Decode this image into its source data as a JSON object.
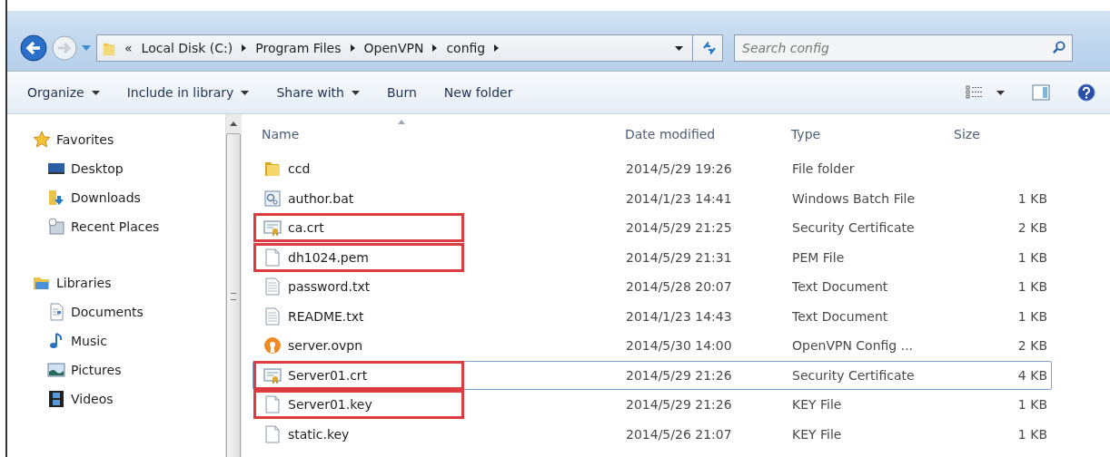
{
  "address_bar": {
    "overflow": "«",
    "segments": [
      "Local Disk (C:)",
      "Program Files",
      "OpenVPN",
      "config"
    ]
  },
  "search": {
    "placeholder": "Search config"
  },
  "toolbar": {
    "items": [
      {
        "label": "Organize",
        "dropdown": true
      },
      {
        "label": "Include in library",
        "dropdown": true
      },
      {
        "label": "Share with",
        "dropdown": true
      },
      {
        "label": "Burn",
        "dropdown": false
      },
      {
        "label": "New folder",
        "dropdown": false
      }
    ]
  },
  "sidebar": {
    "sections": [
      {
        "label": "Favorites",
        "kind": "favorites",
        "children": [
          {
            "label": "Desktop",
            "kind": "desktop"
          },
          {
            "label": "Downloads",
            "kind": "downloads"
          },
          {
            "label": "Recent Places",
            "kind": "recent"
          }
        ]
      },
      {
        "label": "Libraries",
        "kind": "libraries",
        "children": [
          {
            "label": "Documents",
            "kind": "documents"
          },
          {
            "label": "Music",
            "kind": "music"
          },
          {
            "label": "Pictures",
            "kind": "pictures"
          },
          {
            "label": "Videos",
            "kind": "videos"
          }
        ]
      }
    ]
  },
  "table": {
    "columns": [
      "Name",
      "Date modified",
      "Type",
      "Size"
    ],
    "rows": [
      {
        "name": "ccd",
        "kind": "folder",
        "date": "2014/5/29 19:26",
        "type": "File folder",
        "size": "",
        "highlighted": false,
        "focused": false
      },
      {
        "name": "author.bat",
        "kind": "batch",
        "date": "2014/1/23 14:41",
        "type": "Windows Batch File",
        "size": "1 KB",
        "highlighted": false,
        "focused": false
      },
      {
        "name": "ca.crt",
        "kind": "certificate",
        "date": "2014/5/29 21:25",
        "type": "Security Certificate",
        "size": "2 KB",
        "highlighted": true,
        "focused": false
      },
      {
        "name": "dh1024.pem",
        "kind": "file",
        "date": "2014/5/29 21:31",
        "type": "PEM File",
        "size": "1 KB",
        "highlighted": true,
        "focused": false
      },
      {
        "name": "password.txt",
        "kind": "text",
        "date": "2014/5/28 20:07",
        "type": "Text Document",
        "size": "1 KB",
        "highlighted": false,
        "focused": false
      },
      {
        "name": "README.txt",
        "kind": "text",
        "date": "2014/1/23 14:43",
        "type": "Text Document",
        "size": "1 KB",
        "highlighted": false,
        "focused": false
      },
      {
        "name": "server.ovpn",
        "kind": "openvpn",
        "date": "2014/5/30 14:00",
        "type": "OpenVPN Config ...",
        "size": "2 KB",
        "highlighted": false,
        "focused": false
      },
      {
        "name": "Server01.crt",
        "kind": "certificate",
        "date": "2014/5/29 21:26",
        "type": "Security Certificate",
        "size": "4 KB",
        "highlighted": true,
        "focused": true
      },
      {
        "name": "Server01.key",
        "kind": "file",
        "date": "2014/5/29 21:26",
        "type": "KEY File",
        "size": "1 KB",
        "highlighted": true,
        "focused": false
      },
      {
        "name": "static.key",
        "kind": "file",
        "date": "2014/5/26 21:07",
        "type": "KEY File",
        "size": "1 KB",
        "highlighted": false,
        "focused": false
      }
    ]
  }
}
